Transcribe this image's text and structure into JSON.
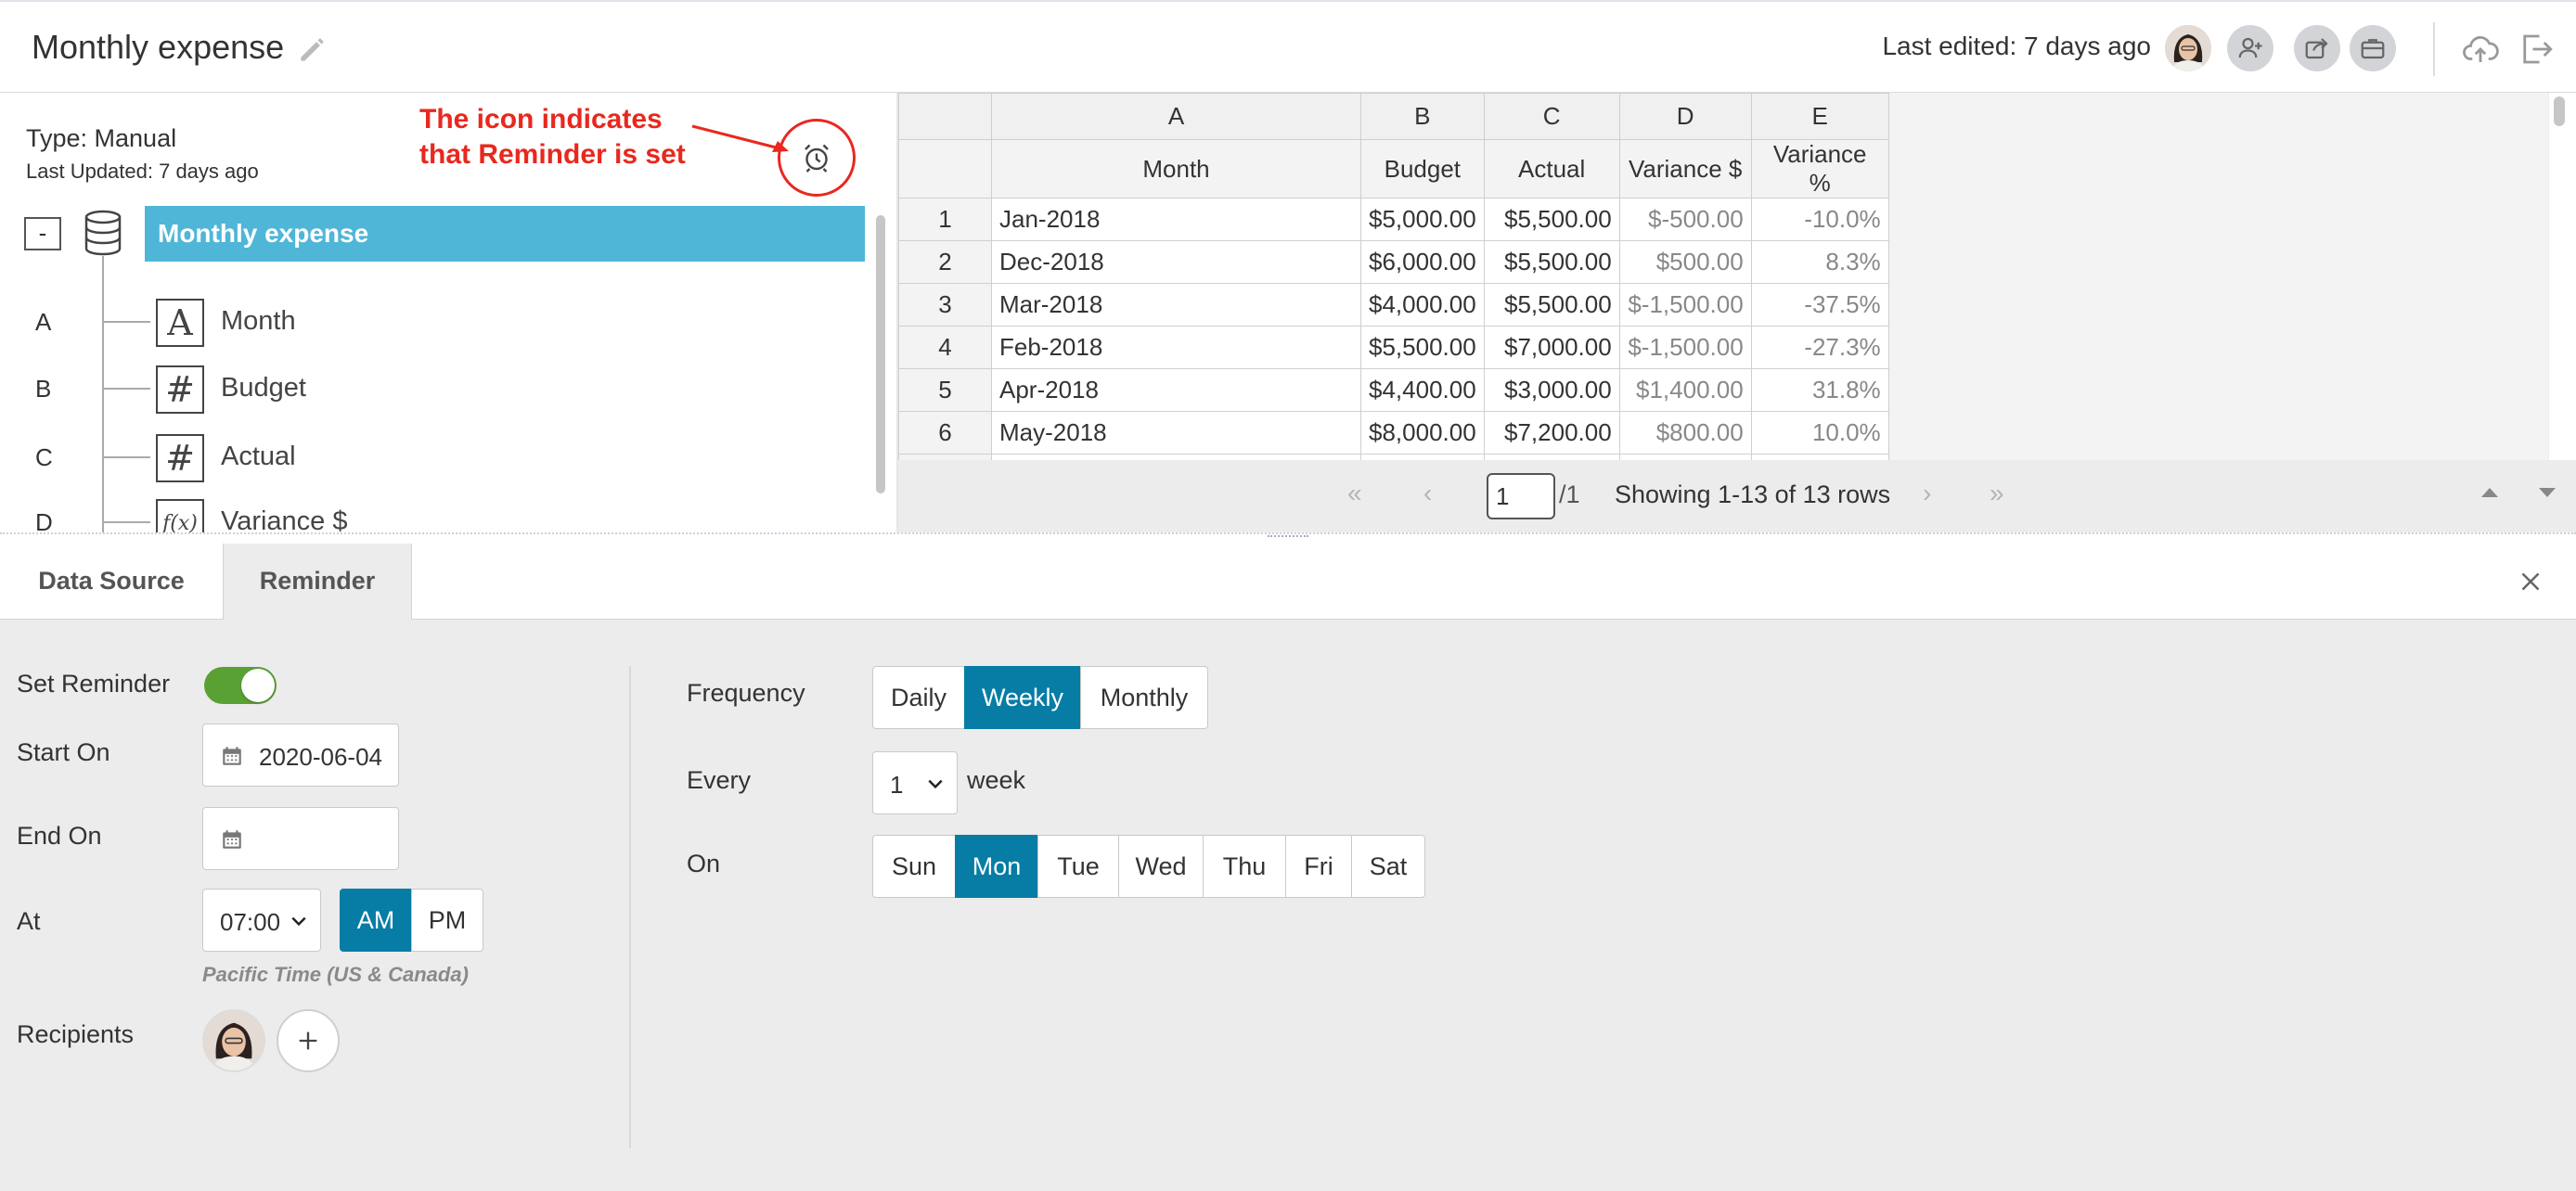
{
  "header": {
    "title": "Monthly expense",
    "last_edited": "Last edited: 7 days ago"
  },
  "left_panel": {
    "type": "Type: Manual",
    "last_updated": "Last Updated: 7 days ago",
    "annotation_line1": "The icon indicates",
    "annotation_line2": "that Reminder is set",
    "collapse_label": "-",
    "root_label": "Monthly expense",
    "fields": [
      {
        "letter": "A",
        "icon": "A",
        "name": "Month"
      },
      {
        "letter": "B",
        "icon": "#",
        "name": "Budget"
      },
      {
        "letter": "C",
        "icon": "#",
        "name": "Actual"
      },
      {
        "letter": "D",
        "icon": "f(x)",
        "name": "Variance $"
      }
    ]
  },
  "grid": {
    "col_letters": [
      "A",
      "B",
      "C",
      "D",
      "E"
    ],
    "headers": [
      "Month",
      "Budget",
      "Actual",
      "Variance $",
      "Variance %"
    ],
    "rows": [
      [
        "1",
        "Jan-2018",
        "$5,000.00",
        "$5,500.00",
        "$-500.00",
        "-10.0%"
      ],
      [
        "2",
        "Dec-2018",
        "$6,000.00",
        "$5,500.00",
        "$500.00",
        "8.3%"
      ],
      [
        "3",
        "Mar-2018",
        "$4,000.00",
        "$5,500.00",
        "$-1,500.00",
        "-37.5%"
      ],
      [
        "4",
        "Feb-2018",
        "$5,500.00",
        "$7,000.00",
        "$-1,500.00",
        "-27.3%"
      ],
      [
        "5",
        "Apr-2018",
        "$4,400.00",
        "$3,000.00",
        "$1,400.00",
        "31.8%"
      ],
      [
        "6",
        "May-2018",
        "$8,000.00",
        "$7,200.00",
        "$800.00",
        "10.0%"
      ]
    ]
  },
  "pager": {
    "page": "1",
    "of": "/1",
    "showing": "Showing 1-13 of 13 rows"
  },
  "tabs": {
    "data_source": "Data Source",
    "reminder": "Reminder"
  },
  "reminder": {
    "set_reminder_label": "Set Reminder",
    "enabled": true,
    "start_on_label": "Start On",
    "start_on_value": "2020-06-04",
    "end_on_label": "End On",
    "end_on_value": "",
    "at_label": "At",
    "at_value": "07:00",
    "am": "AM",
    "pm": "PM",
    "ampm_selected": "AM",
    "timezone": "Pacific Time (US & Canada)",
    "recipients_label": "Recipients",
    "frequency_label": "Frequency",
    "frequency_options": [
      "Daily",
      "Weekly",
      "Monthly"
    ],
    "frequency_selected": "Weekly",
    "every_label": "Every",
    "every_value": "1",
    "every_unit": "week",
    "on_label": "On",
    "days": [
      "Sun",
      "Mon",
      "Tue",
      "Wed",
      "Thu",
      "Fri",
      "Sat"
    ],
    "day_selected": "Mon"
  },
  "colors": {
    "accent": "#077da5",
    "tree_root": "#4fb6d8",
    "toggle_on": "#5aa133",
    "annotation": "#e8281e"
  }
}
